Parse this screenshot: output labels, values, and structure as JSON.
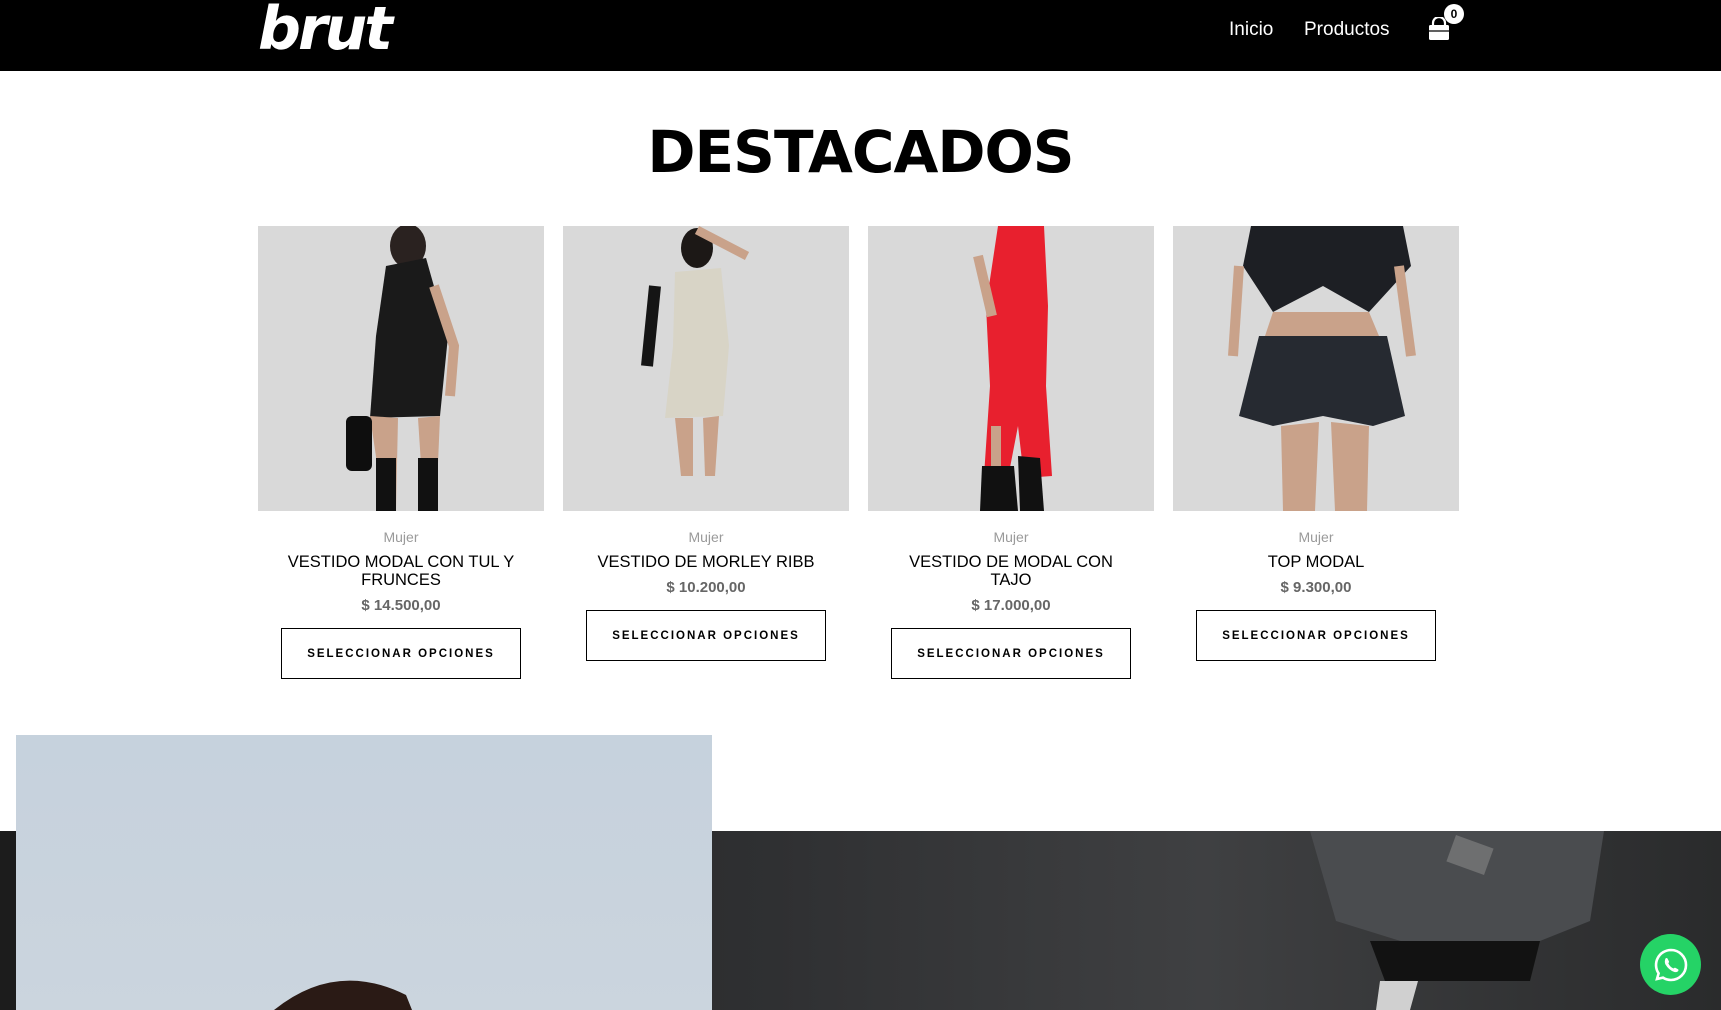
{
  "header": {
    "logo": "brut",
    "nav": [
      {
        "label": "Inicio"
      },
      {
        "label": "Productos"
      }
    ],
    "cart": {
      "icon": "shopping-bag-icon",
      "count": "0"
    }
  },
  "section": {
    "title": "DESTACADOS"
  },
  "products": [
    {
      "category": "Mujer",
      "name": "VESTIDO MODAL CON TUL Y FRUNCES",
      "price": "$ 14.500,00",
      "button": "SELECCIONAR OPCIONES",
      "garment_color": "#1a1a1a"
    },
    {
      "category": "Mujer",
      "name": "VESTIDO DE MORLEY RIBB",
      "price": "$ 10.200,00",
      "button": "SELECCIONAR OPCIONES",
      "garment_color": "#d8d4c6"
    },
    {
      "category": "Mujer",
      "name": "VESTIDO DE MODAL CON TAJO",
      "price": "$ 17.000,00",
      "button": "SELECCIONAR OPCIONES",
      "garment_color": "#e8202e"
    },
    {
      "category": "Mujer",
      "name": "TOP MODAL",
      "price": "$ 9.300,00",
      "button": "SELECCIONAR OPCIONES",
      "garment_color": "#1d1f24"
    }
  ],
  "floating": {
    "icon": "whatsapp-icon",
    "color": "#25d366"
  }
}
